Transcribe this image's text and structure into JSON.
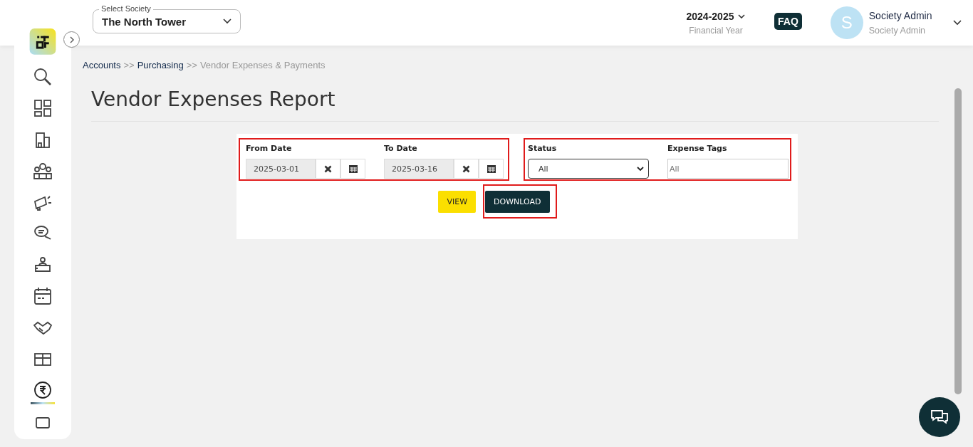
{
  "header": {
    "society_label": "Select Society",
    "society": "The North Tower",
    "year": "2024-2025",
    "year_caption": "Financial Year",
    "faq": "FAQ",
    "avatar_letter": "S",
    "user_name": "Society Admin",
    "user_role": "Society Admin"
  },
  "sidebar": {
    "items": [
      {
        "selected": false
      },
      {
        "selected": false
      },
      {
        "selected": false
      },
      {
        "selected": false
      },
      {
        "selected": false
      },
      {
        "selected": false
      },
      {
        "selected": false
      },
      {
        "selected": false
      },
      {
        "selected": false
      },
      {
        "selected": false
      },
      {
        "selected": true
      },
      {
        "selected": false
      }
    ]
  },
  "breadcrumb": [
    {
      "label": "Accounts",
      "current": false
    },
    {
      "label": "Purchasing",
      "current": false
    },
    {
      "label": "Vendor Expenses & Payments",
      "current": true
    }
  ],
  "breadcrumb_separator": ">>",
  "page_title": "Vendor Expenses Report",
  "filters": {
    "from_label": "From Date",
    "from_value": "2025-03-01",
    "to_label": "To Date",
    "to_value": "2025-03-16",
    "status_label": "Status",
    "status_value": "All",
    "tags_label": "Expense Tags",
    "tags_placeholder": "All"
  },
  "buttons": [
    {
      "label": "VIEW",
      "kind": "view",
      "highlighted": false
    },
    {
      "label": "DOWNLOAD",
      "kind": "download",
      "highlighted": true
    }
  ]
}
